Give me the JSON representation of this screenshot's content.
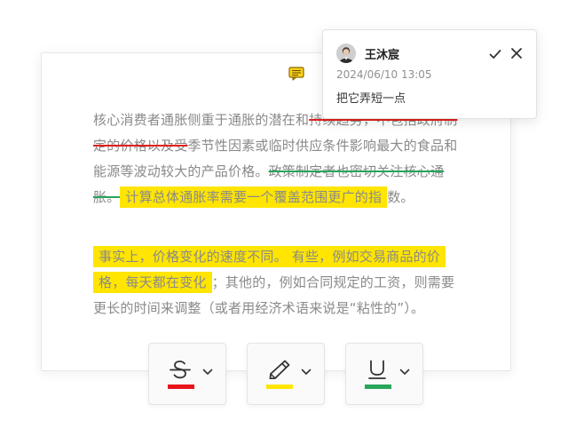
{
  "document": {
    "paragraph1": {
      "seg_a": "核心消费者通胀侧重于通胀的潜在和",
      "seg_b_deleted_red": "持续趋势，不包括政府制定的价格以及受",
      "seg_c": "季节性因素或临时供应条件影响最大的食品和能源等波动较大的产品价格。",
      "seg_d_deleted_green": "政策制定者也密切关注核心通胀。",
      "seg_e_highlighted": "计算总体通胀率需要一个覆盖范围更广的指",
      "seg_f": "数。"
    },
    "paragraph2": {
      "seg_a_highlighted": "事实上，价格变化的速度不同。 有些，例如交易商品的价格，每天都在变化",
      "seg_b": "；其他的，例如合同规定的工资，则需要更长的时间来调整（或者用经济术语来说是“粘性的”）。"
    }
  },
  "comment": {
    "author": "王沐宸",
    "timestamp": "2024/06/10 13:05",
    "text": "把它弄短一点"
  },
  "toolbar": {
    "tools": [
      {
        "name": "strikethrough",
        "color": "#e8141b"
      },
      {
        "name": "highlight",
        "color": "#ffe500"
      },
      {
        "name": "underline",
        "color": "#2aa65a"
      }
    ]
  },
  "colors": {
    "highlight": "#ffe500",
    "delete_red": "#e0201e",
    "delete_green": "#27a55a",
    "body_text": "#8a8a8a"
  }
}
